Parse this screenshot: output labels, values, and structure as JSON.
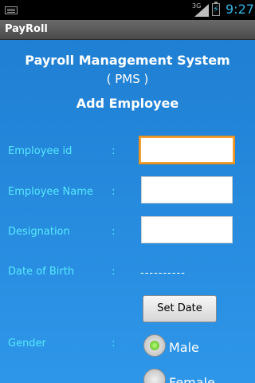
{
  "statusbar": {
    "network": "3G",
    "time": "9:27",
    "keyboard_icon": "keyboard-icon",
    "signal_icon": "signal-icon",
    "battery_icon": "battery-charging-icon"
  },
  "app": {
    "title": "PayRoll"
  },
  "header": {
    "line1": "Payroll Management System",
    "line2": "( PMS )",
    "line3": "Add Employee"
  },
  "form": {
    "colon": ":",
    "employee_id_label": "Employee id",
    "employee_id_value": "",
    "employee_name_label": "Employee Name",
    "employee_name_value": "",
    "designation_label": "Designation",
    "designation_value": "",
    "dob_label": "Date of Birth",
    "dob_value": "----------",
    "set_date_label": "Set Date",
    "gender_label": "Gender",
    "gender_options": [
      {
        "label": "Male",
        "selected": true
      },
      {
        "label": "Female",
        "selected": false
      }
    ]
  },
  "colors": {
    "background_top": "#1f7fd3",
    "background_bottom": "#2e96e8",
    "label": "#55eaff",
    "focus": "#f3a032"
  }
}
